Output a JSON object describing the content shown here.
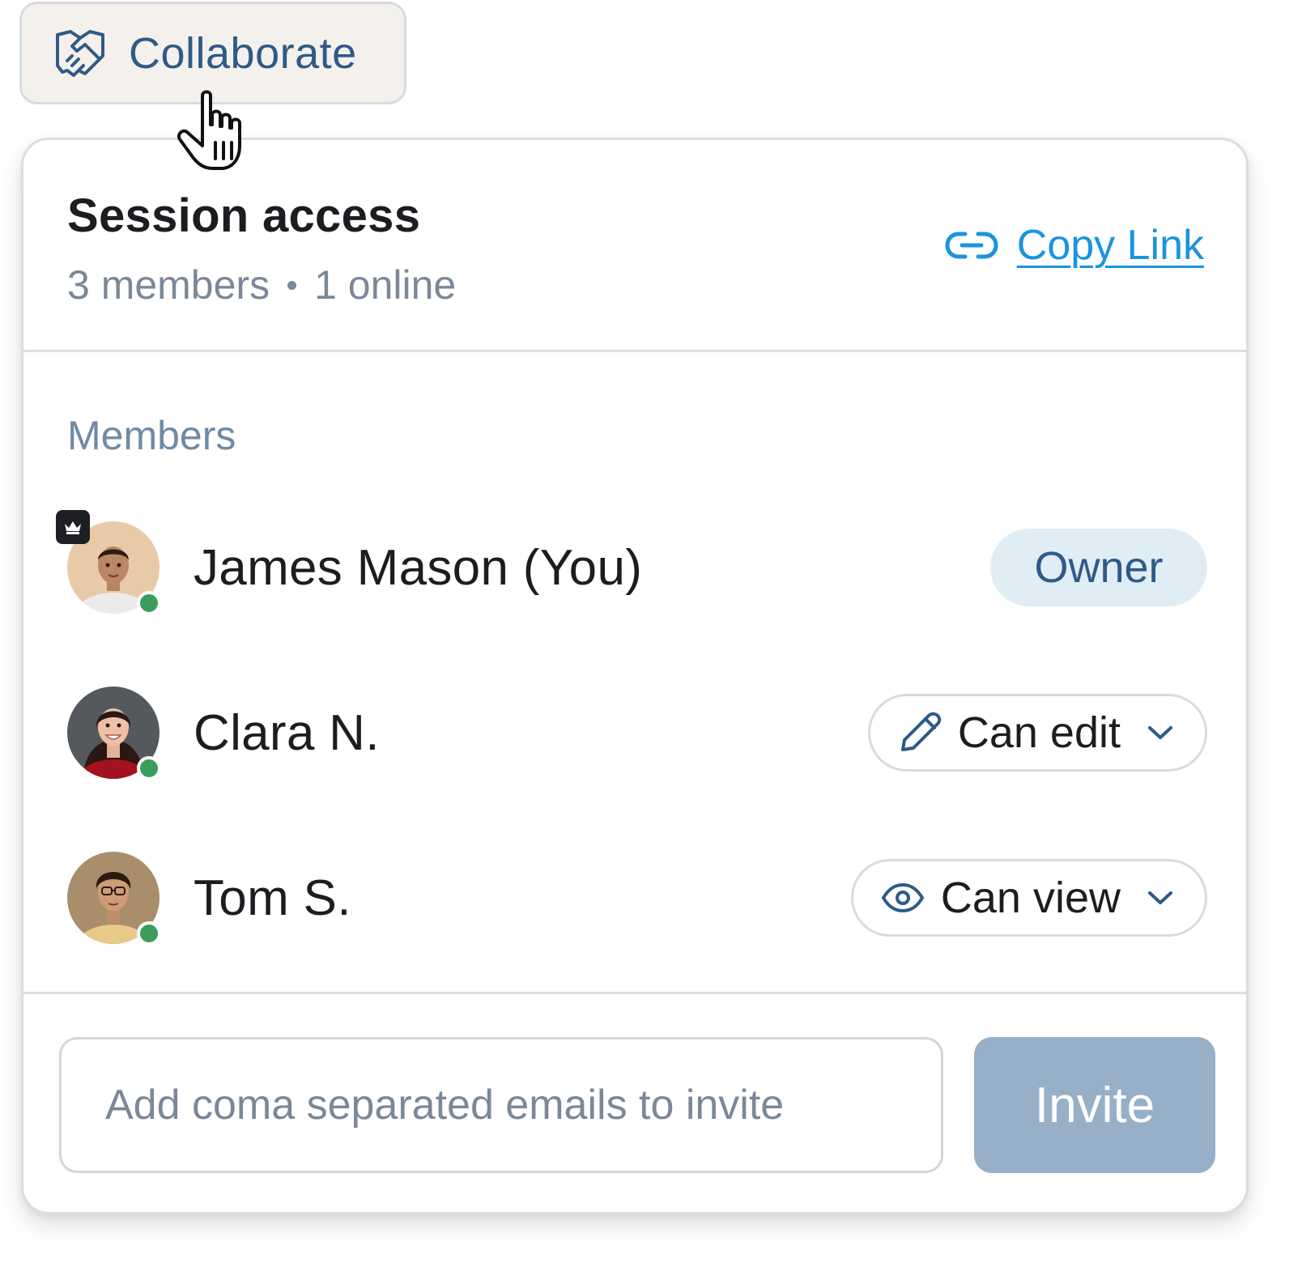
{
  "trigger": {
    "label": "Collaborate",
    "icon": "handshake-icon"
  },
  "panel": {
    "title": "Session access",
    "member_count": "3 members",
    "online_count": "1 online",
    "copy_link_label": "Copy Link",
    "members_heading": "Members"
  },
  "members": [
    {
      "name": "James Mason (You)",
      "role": "Owner",
      "online": true,
      "is_owner": true
    },
    {
      "name": "Clara N.",
      "role": "Can edit",
      "role_icon": "pencil-icon",
      "online": true
    },
    {
      "name": "Tom S.",
      "role": "Can view",
      "role_icon": "eye-icon",
      "online": true
    }
  ],
  "invite": {
    "placeholder": "Add coma separated emails to invite",
    "value": "",
    "button_label": "Invite"
  },
  "colors": {
    "accent": "#2e5a88",
    "link": "#1a94df",
    "online": "#3a9d5d",
    "owner_pill_bg": "#e0edf5",
    "invite_disabled_bg": "#97b0c8",
    "trigger_bg": "#f4f1ec"
  }
}
